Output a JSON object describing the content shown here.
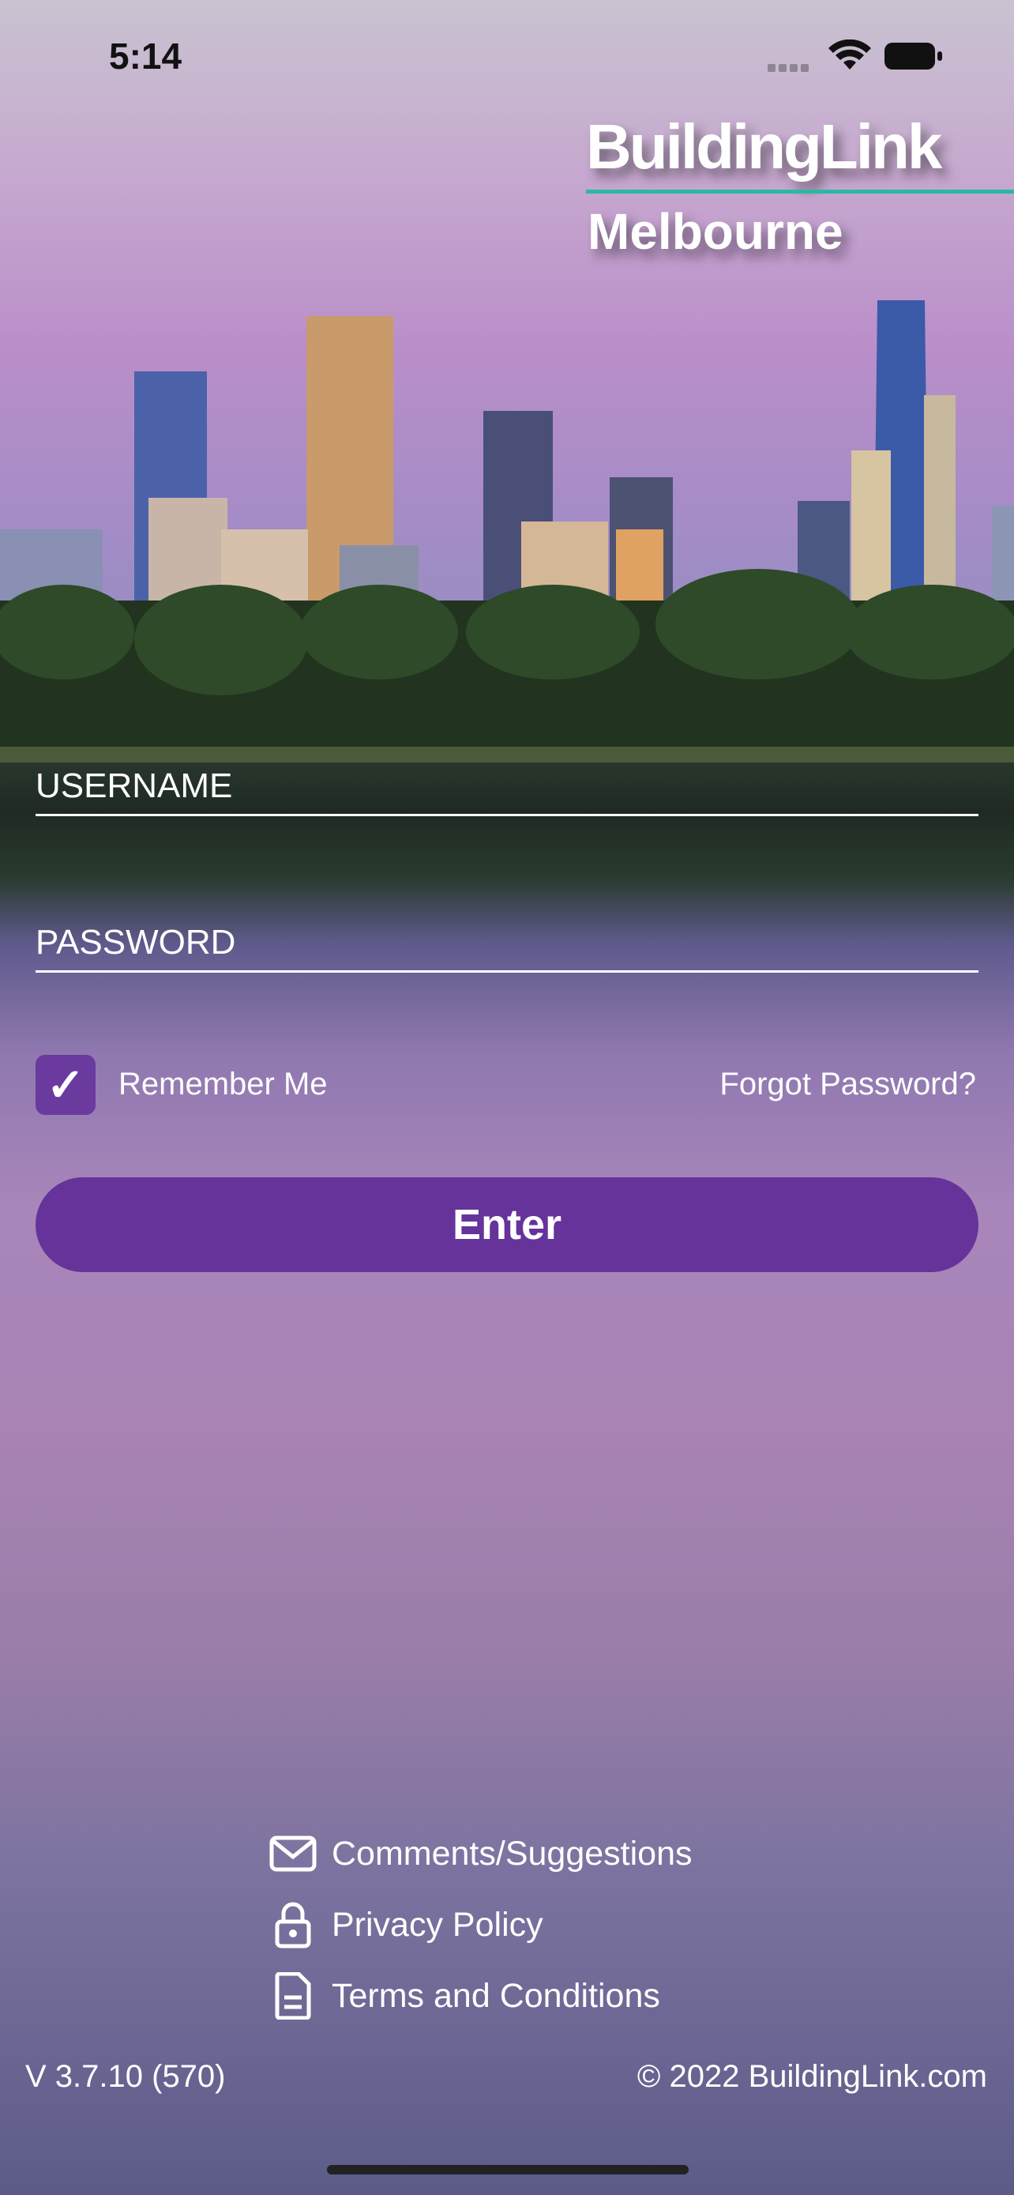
{
  "status_bar": {
    "time": "5:14"
  },
  "logo": {
    "brand": "BuildingLink",
    "city": "Melbourne"
  },
  "login": {
    "username_placeholder": "USERNAME",
    "password_placeholder": "PASSWORD",
    "remember_label": "Remember Me",
    "remember_checked": true,
    "forgot_label": "Forgot Password?",
    "enter_label": "Enter"
  },
  "footer": {
    "links": [
      {
        "label": "Comments/Suggestions",
        "icon": "mail-icon"
      },
      {
        "label": "Privacy Policy",
        "icon": "lock-icon"
      },
      {
        "label": "Terms and Conditions",
        "icon": "document-icon"
      }
    ],
    "version": "V 3.7.10 (570)",
    "copyright": "© 2022 BuildingLink.com"
  },
  "colors": {
    "accent": "#66339a",
    "logo_line": "#2bb8a3"
  }
}
